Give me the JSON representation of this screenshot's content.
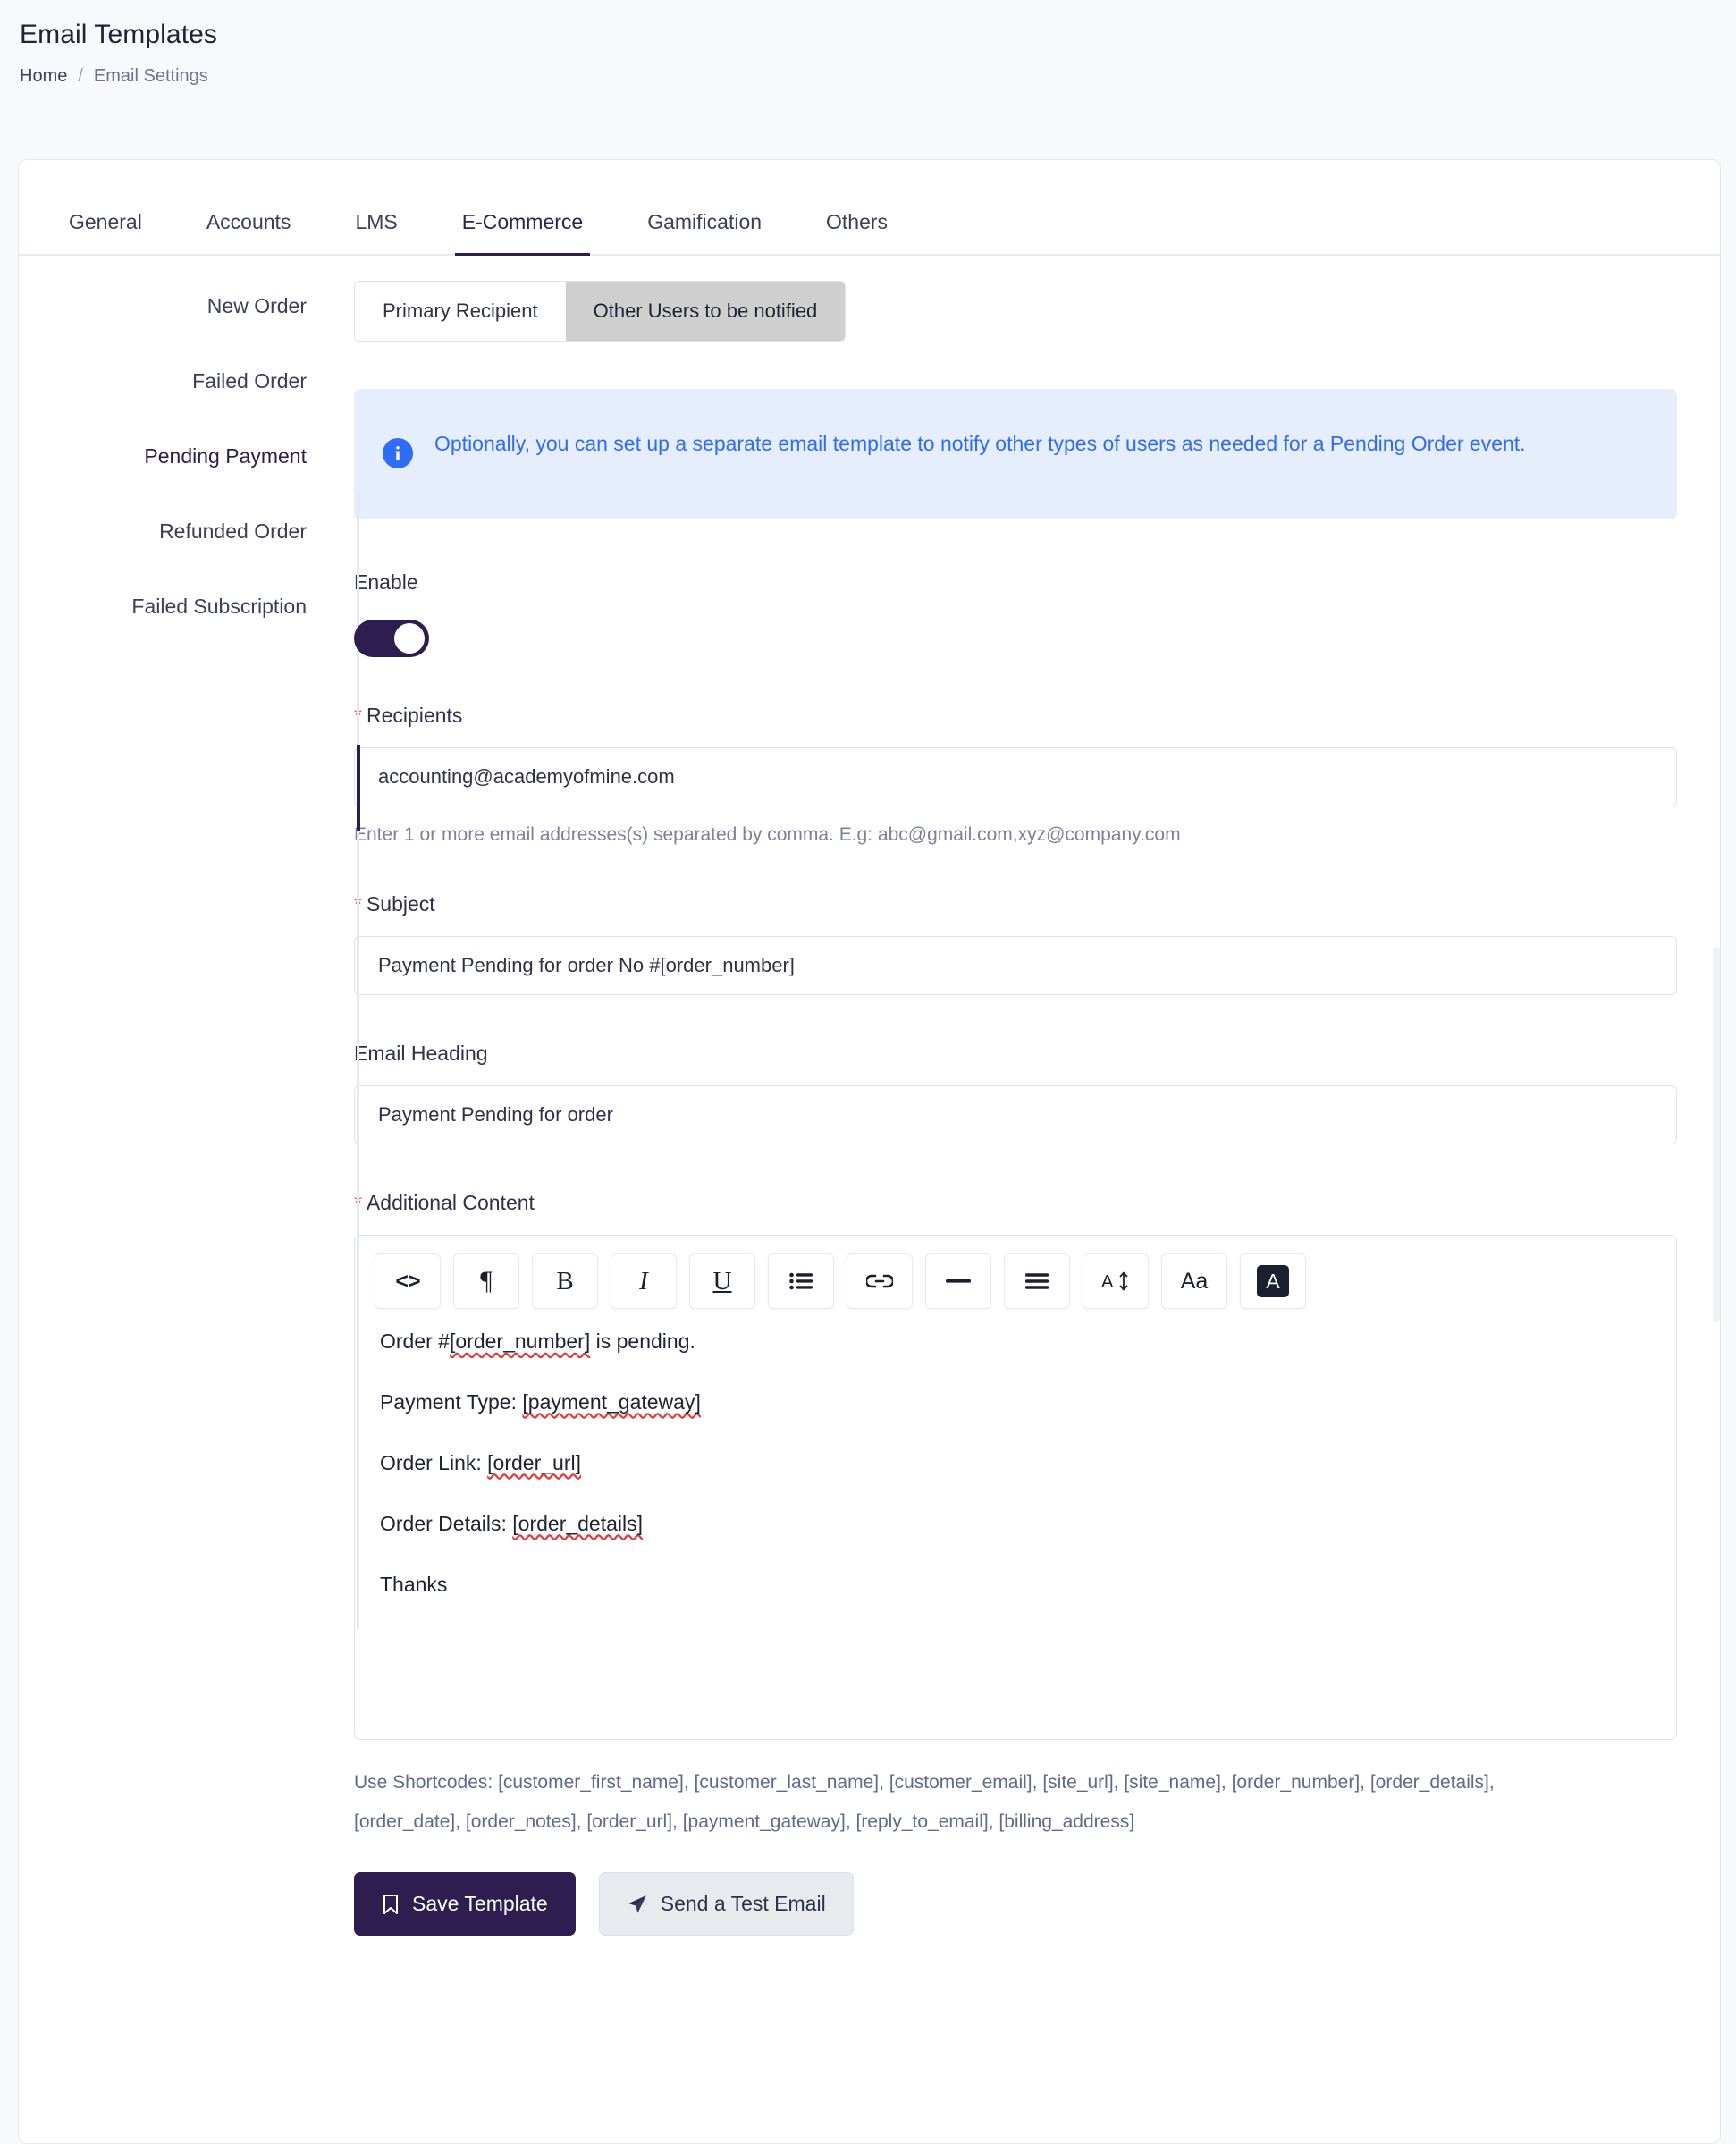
{
  "header": {
    "title": "Email Templates",
    "breadcrumb": {
      "home": "Home",
      "separator": "/",
      "current": "Email Settings"
    }
  },
  "tabs": [
    {
      "label": "General",
      "active": false
    },
    {
      "label": "Accounts",
      "active": false
    },
    {
      "label": "LMS",
      "active": false
    },
    {
      "label": "E-Commerce",
      "active": true
    },
    {
      "label": "Gamification",
      "active": false
    },
    {
      "label": "Others",
      "active": false
    }
  ],
  "side_nav": [
    {
      "label": "New Order",
      "active": false
    },
    {
      "label": "Failed Order",
      "active": false
    },
    {
      "label": "Pending Payment",
      "active": true
    },
    {
      "label": "Refunded Order",
      "active": false
    },
    {
      "label": "Failed Subscription",
      "active": false
    }
  ],
  "segmented": [
    {
      "label": "Primary Recipient",
      "active": false
    },
    {
      "label": "Other Users to be notified",
      "active": true
    }
  ],
  "info_banner": {
    "icon": "info-icon",
    "glyph": "i",
    "text": "Optionally, you can set up a separate email template to notify other types of users as needed for a Pending Order event."
  },
  "form": {
    "enable": {
      "label": "Enable",
      "state": "on"
    },
    "recipients": {
      "label": "Recipients",
      "required": true,
      "required_mark": "*",
      "value": "accounting@academyofmine.com",
      "placeholder": "accounting@academyofmine.com",
      "help": "Enter 1 or more email addresses(s) separated by comma. E.g: abc@gmail.com,xyz@company.com"
    },
    "subject": {
      "label": "Subject",
      "required": true,
      "required_mark": "*",
      "value": "Payment Pending for order No #[order_number]",
      "placeholder": "Payment Pending for order No #[order_number]"
    },
    "email_heading": {
      "label": "Email Heading",
      "required": false,
      "value": "Payment Pending for order",
      "placeholder": "Payment Pending for order"
    },
    "additional_content": {
      "label": "Additional Content",
      "required": true,
      "required_mark": "*"
    }
  },
  "editor": {
    "toolbar": [
      {
        "name": "code-icon",
        "glyph": "<>",
        "title": "Source code"
      },
      {
        "name": "paragraph-icon",
        "glyph": "¶",
        "title": "Paragraph"
      },
      {
        "name": "bold-icon",
        "glyph": "B",
        "title": "Bold"
      },
      {
        "name": "italic-icon",
        "glyph": "I",
        "title": "Italic"
      },
      {
        "name": "underline-icon",
        "glyph": "U",
        "title": "Underline"
      },
      {
        "name": "bullet-list-icon",
        "glyph": "☰",
        "title": "Bullet list"
      },
      {
        "name": "link-icon",
        "glyph": "⚭",
        "title": "Insert link"
      },
      {
        "name": "horizontal-rule-icon",
        "glyph": "—",
        "title": "Horizontal rule"
      },
      {
        "name": "align-icon",
        "glyph": "≡",
        "title": "Alignment"
      },
      {
        "name": "font-size-icon",
        "glyph": "A↕",
        "title": "Font size"
      },
      {
        "name": "text-case-icon",
        "glyph": "Aa",
        "title": "Text case"
      },
      {
        "name": "text-color-icon",
        "glyph": "A",
        "title": "Text color"
      }
    ],
    "content_lines": [
      {
        "prefix": "Order #",
        "token": "[order_number]",
        "suffix": " is pending."
      },
      {
        "prefix": "Payment Type: ",
        "token": "[payment_gateway]",
        "suffix": ""
      },
      {
        "prefix": "Order Link:  ",
        "token": "[order_url]",
        "suffix": ""
      },
      {
        "prefix": "Order Details: ",
        "token": "[order_details]",
        "suffix": ""
      },
      {
        "prefix": "Thanks",
        "token": "",
        "suffix": ""
      }
    ]
  },
  "shortcodes": {
    "line1": "Use Shortcodes: [customer_first_name], [customer_last_name], [customer_email], [site_url], [site_name], [order_number], [order_details],",
    "line2": "[order_date], [order_notes], [order_url], [payment_gateway], [reply_to_email], [billing_address]"
  },
  "actions": {
    "save": {
      "label": "Save Template",
      "icon": "bookmark-icon"
    },
    "test": {
      "label": "Send a Test Email",
      "icon": "paper-plane-icon"
    }
  },
  "colors": {
    "accent_purple": "#2d1e4f",
    "info_blue": "#2f6df6",
    "info_bg": "#e6edfd",
    "required_red": "#f2636c",
    "page_bg": "#f8f9fa",
    "segment_active": "#cfcfcf"
  }
}
